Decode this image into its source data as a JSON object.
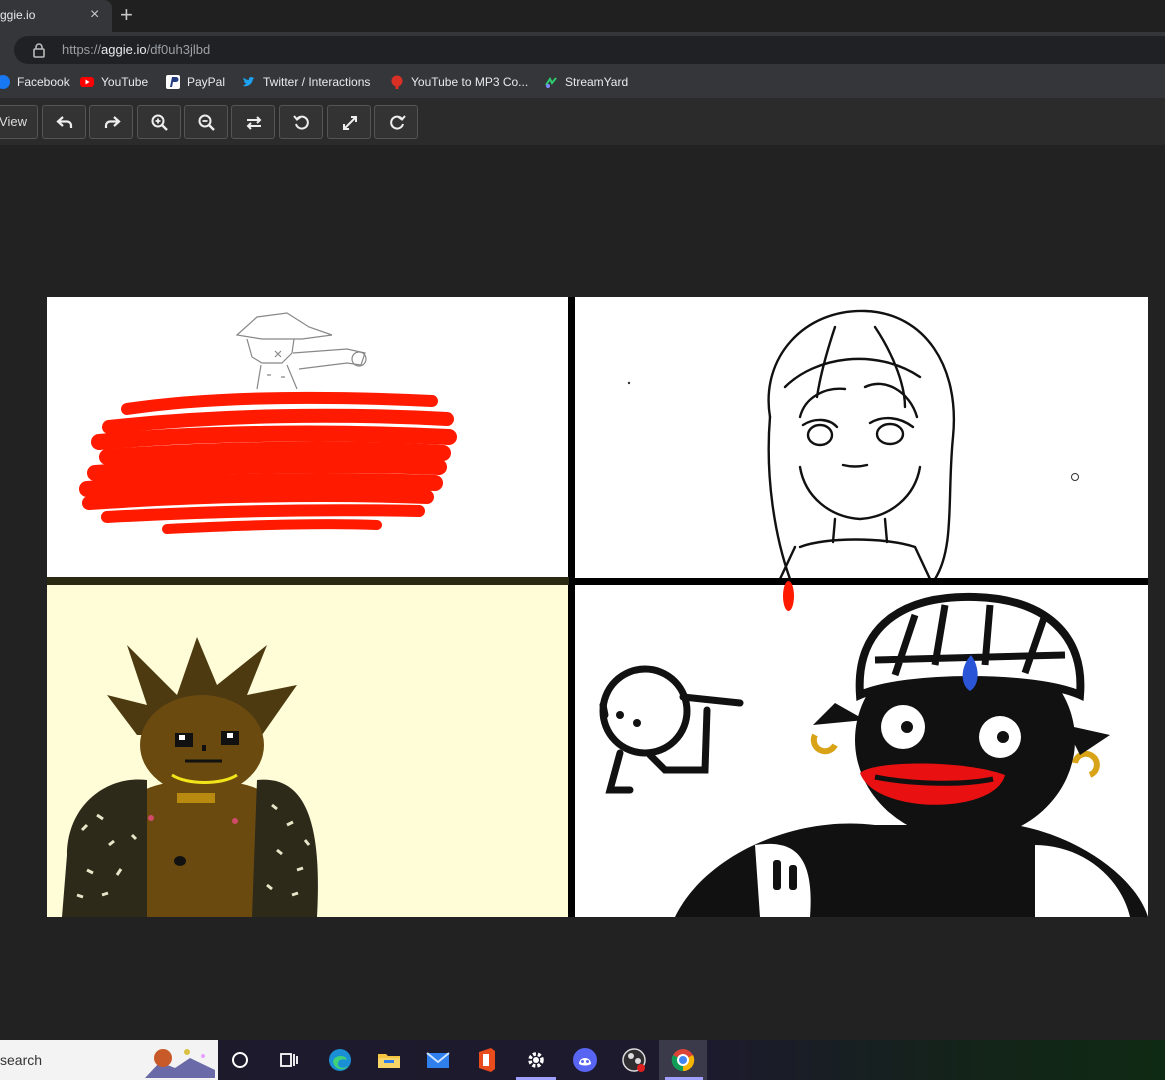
{
  "browser": {
    "tab_title": "ggie.io",
    "tab_close": "×",
    "new_tab": "+",
    "url_scheme": "https://",
    "url_host": "aggie.io",
    "url_path": "/df0uh3jlbd"
  },
  "bookmarks": [
    {
      "label": "Facebook",
      "icon": "facebook-icon",
      "color": "#1877f2"
    },
    {
      "label": "YouTube",
      "icon": "youtube-icon",
      "color": "#ff0000"
    },
    {
      "label": "PayPal",
      "icon": "paypal-icon",
      "color": "#253b80"
    },
    {
      "label": "Twitter / Interactions",
      "icon": "twitter-icon",
      "color": "#1da1f2"
    },
    {
      "label": "YouTube to MP3 Co...",
      "icon": "mp3-converter-icon",
      "color": "#d93025"
    },
    {
      "label": "StreamYard",
      "icon": "streamyard-icon",
      "color": "#2ecc71"
    }
  ],
  "toolbar": {
    "view_label": "View",
    "buttons": [
      "undo-icon",
      "redo-icon",
      "zoom-in-icon",
      "zoom-out-icon",
      "swap-icon",
      "rotate-left-icon",
      "fullscreen-icon",
      "rotate-right-icon"
    ]
  },
  "taskbar": {
    "search_text": "search",
    "apps": [
      "cortana-icon",
      "task-view-icon",
      "edge-icon",
      "file-explorer-icon",
      "mail-icon",
      "office-icon",
      "settings-icon",
      "discord-icon",
      "obs-icon",
      "chrome-icon"
    ]
  },
  "colors": {
    "red_scribble": "#ff1a00",
    "panel_cream": "#fefdd8",
    "brown_skin": "#6b4a10",
    "lip_red": "#e81010",
    "earring_gold": "#d9a318",
    "gem_blue": "#2a55d6"
  }
}
